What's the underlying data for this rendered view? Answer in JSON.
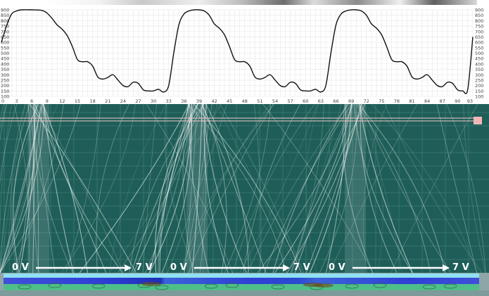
{
  "chart_data": {
    "type": "line",
    "title": "",
    "xlabel": "",
    "ylabel": "",
    "xlim": [
      0,
      93
    ],
    "ylim": [
      100,
      900
    ],
    "x_ticks": [
      0,
      3,
      6,
      9,
      12,
      15,
      18,
      21,
      24,
      27,
      30,
      33,
      36,
      39,
      42,
      45,
      48,
      51,
      54,
      57,
      60,
      63,
      66,
      69,
      72,
      75,
      78,
      81,
      84,
      87,
      90,
      93
    ],
    "x_tick_labels": [
      "0",
      "3",
      "6",
      "9",
      "12",
      "15",
      "18",
      "21",
      "24",
      "27",
      "30",
      "33",
      "36",
      "39",
      "42",
      "45",
      "48",
      "51",
      "54",
      "57",
      "60",
      "63",
      "66",
      "69",
      "72",
      "75",
      "78",
      "81",
      "84",
      "87",
      "90",
      "93"
    ],
    "y_ticks": [
      100,
      150,
      200,
      250,
      300,
      350,
      400,
      450,
      500,
      550,
      600,
      650,
      700,
      750,
      800,
      850,
      900
    ],
    "y_tick_labels": [
      "100",
      "150",
      "200",
      "250",
      "300",
      "350",
      "400",
      "450",
      "500",
      "550",
      "600",
      "650",
      "700",
      "750",
      "800",
      "850",
      "900"
    ],
    "grid": true,
    "series": [
      {
        "x": [
          0,
          1,
          2,
          3,
          4,
          6,
          8,
          9,
          10,
          11,
          12,
          13,
          14,
          15,
          16,
          17,
          18,
          19,
          20,
          21,
          22,
          23,
          24,
          25,
          26,
          27,
          28,
          29,
          30,
          31,
          32,
          33,
          34,
          35,
          36,
          37,
          38,
          39,
          40,
          41,
          42,
          43,
          44,
          45,
          46,
          47,
          48,
          49,
          50,
          51,
          52,
          53,
          54,
          55,
          56,
          57,
          58,
          59,
          60,
          61,
          62,
          63,
          64,
          65,
          66,
          67,
          68,
          69,
          70,
          71,
          72,
          73,
          74,
          75,
          76,
          77,
          78,
          79,
          80,
          81,
          82,
          83,
          84,
          85,
          86,
          87,
          88,
          89,
          90,
          91,
          92,
          93
        ],
        "y": [
          600,
          750,
          860,
          890,
          900,
          900,
          895,
          870,
          820,
          760,
          720,
          660,
          560,
          440,
          420,
          420,
          380,
          280,
          260,
          275,
          300,
          250,
          200,
          190,
          230,
          220,
          160,
          150,
          150,
          165,
          140,
          200,
          500,
          760,
          860,
          890,
          900,
          900,
          890,
          850,
          770,
          730,
          670,
          560,
          440,
          420,
          420,
          380,
          280,
          260,
          275,
          300,
          250,
          200,
          190,
          230,
          220,
          160,
          150,
          150,
          165,
          140,
          200,
          500,
          760,
          860,
          890,
          900,
          900,
          890,
          850,
          770,
          730,
          670,
          560,
          440,
          420,
          420,
          380,
          280,
          260,
          275,
          300,
          250,
          200,
          190,
          230,
          220,
          160,
          150,
          165,
          650
        ]
      }
    ]
  },
  "overlay": {
    "voltage_labels": [
      {
        "start": "0 V",
        "end": "7 V"
      },
      {
        "start": "0 V",
        "end": "7 V"
      },
      {
        "start": "0 V",
        "end": "7 V"
      }
    ]
  },
  "colors": {
    "line": "#111111",
    "grid": "#e6e6e6",
    "tick_text": "#444444",
    "teal_background": "#1f5e58",
    "strand": "#ffffff",
    "arrow": "#ffffff",
    "marker": "#f0b7b7",
    "strip_blue": "#2f3fd6",
    "strip_green": "#2ea76a",
    "strip_cyan": "#8fe0f0",
    "strip_bottom": "#7f9a9a"
  }
}
